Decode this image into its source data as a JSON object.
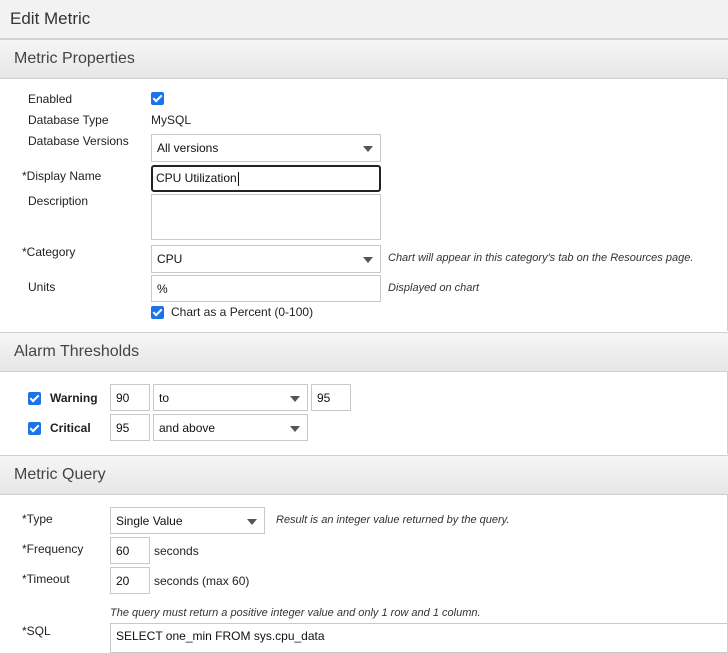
{
  "page": {
    "title": "Edit Metric"
  },
  "properties": {
    "section_title": "Metric Properties",
    "enabled_label": "Enabled",
    "enabled_checked": true,
    "db_type_label": "Database Type",
    "db_type_value": "MySQL",
    "db_versions_label": "Database Versions",
    "db_versions_value": "All versions",
    "display_name_label": "*Display Name",
    "display_name_value": "CPU Utilization",
    "description_label": "Description",
    "description_value": "",
    "category_label": "*Category",
    "category_value": "CPU",
    "category_note": "Chart will appear in this category's tab on the Resources page.",
    "units_label": "Units",
    "units_value": "%",
    "units_note": "Displayed on chart",
    "percent_label": "Chart as a Percent (0-100)",
    "percent_checked": true
  },
  "alarms": {
    "section_title": "Alarm Thresholds",
    "warning_label": "Warning",
    "warning_checked": true,
    "warning_value": "90",
    "warning_op": "to",
    "warning_upper": "95",
    "critical_label": "Critical",
    "critical_checked": true,
    "critical_value": "95",
    "critical_op": "and above"
  },
  "query": {
    "section_title": "Metric Query",
    "type_label": "*Type",
    "type_value": "Single Value",
    "type_note": "Result is an integer value returned by the query.",
    "frequency_label": "*Frequency",
    "frequency_value": "60",
    "frequency_unit": "seconds",
    "timeout_label": "*Timeout",
    "timeout_value": "20",
    "timeout_unit": "seconds (max 60)",
    "sql_note": "The query must return a positive integer value and only 1 row and 1 column.",
    "sql_label": "*SQL",
    "sql_value": "SELECT one_min FROM sys.cpu_data"
  }
}
